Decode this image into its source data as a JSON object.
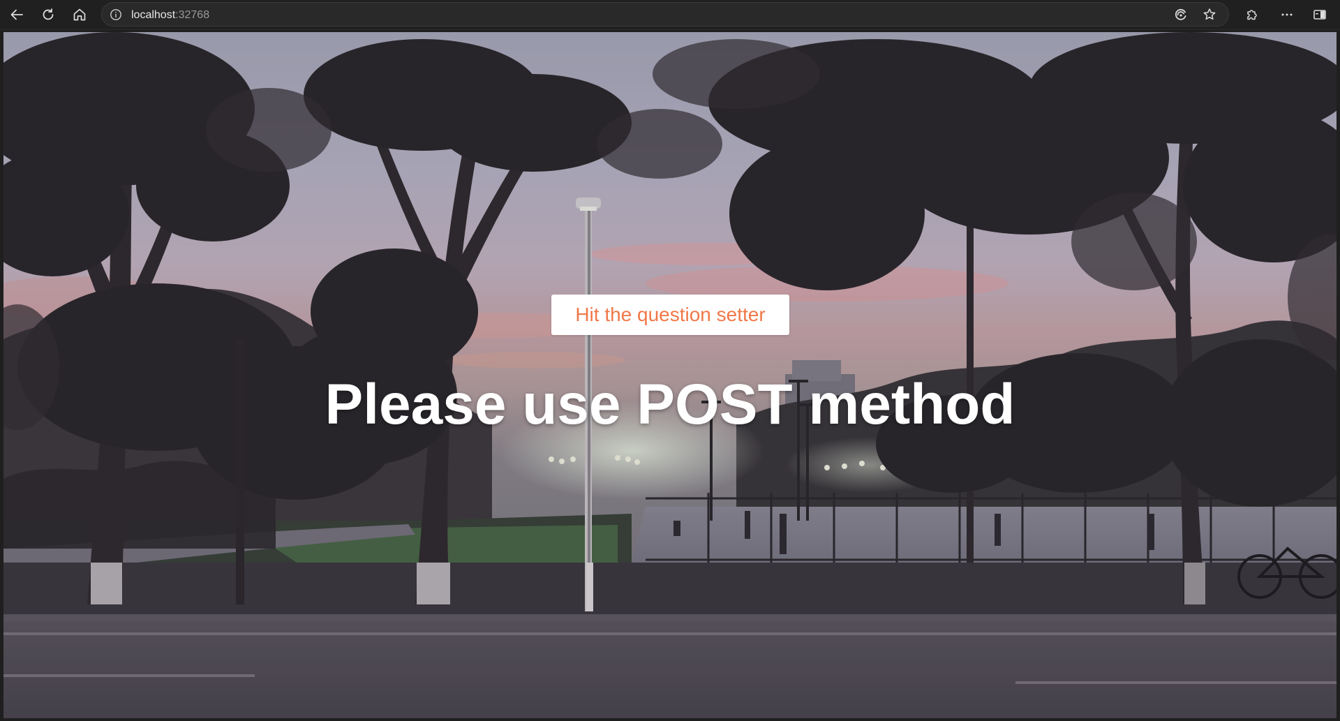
{
  "browser": {
    "url_host": "localhost",
    "url_port": ":32768",
    "icons": {
      "back": "back-arrow-icon",
      "reload": "reload-icon",
      "home": "home-icon",
      "site_info": "info-circle-icon",
      "read_aloud": "read-aloud-icon",
      "favorite": "star-icon",
      "extensions": "puzzle-icon",
      "more": "more-dots-icon",
      "sidebar": "sidebar-toggle-icon"
    }
  },
  "page": {
    "button_label": "Hit the question setter",
    "headline": "Please use POST method",
    "background": "photo of a park at sunset with trees, street lamps, a sports court and a road",
    "colors": {
      "button_text": "#f07848",
      "button_bg": "#ffffff",
      "headline_text": "#ffffff"
    }
  }
}
